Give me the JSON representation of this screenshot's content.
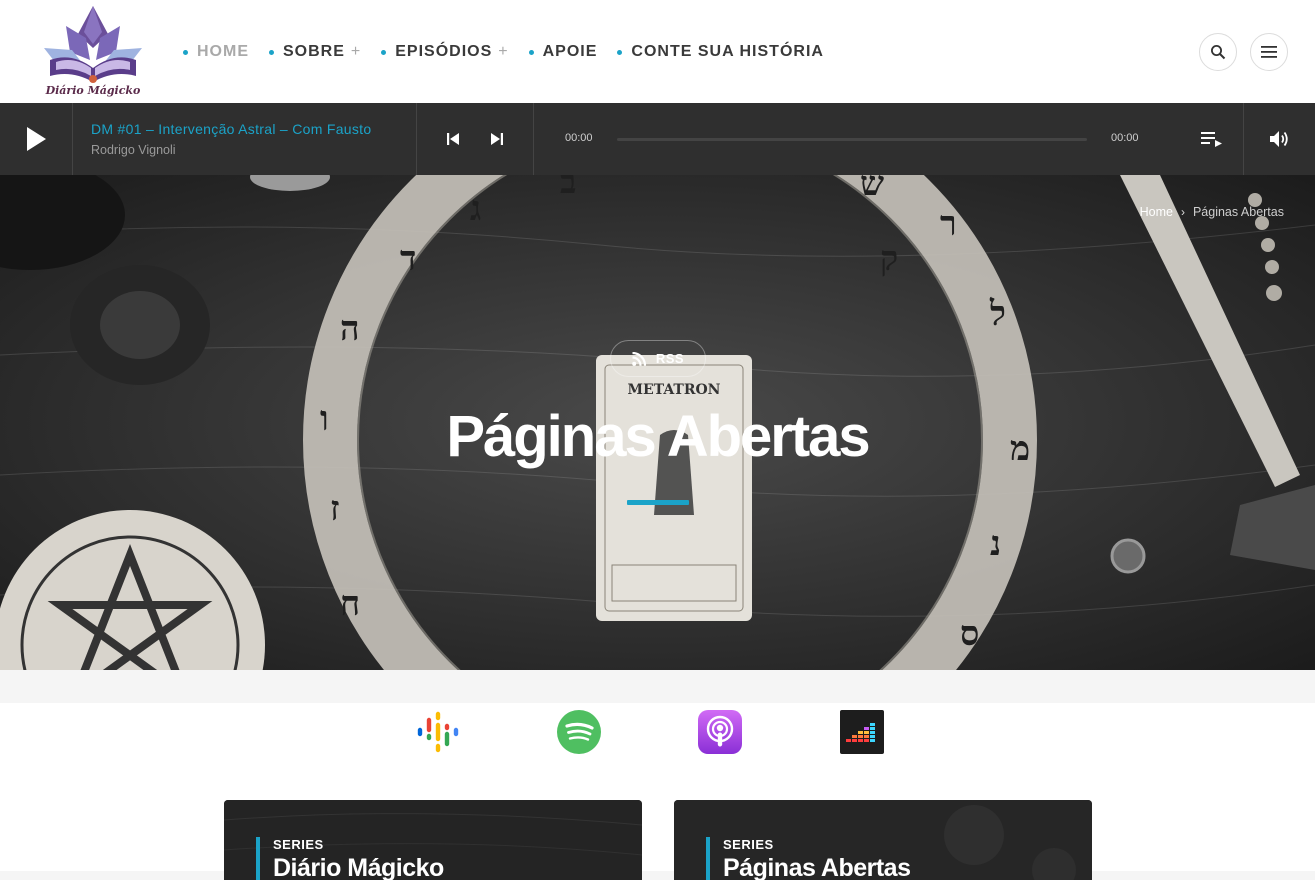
{
  "header": {
    "logo_text": "Diário Mágicko",
    "nav": [
      {
        "label": "HOME",
        "active": true,
        "has_submenu": false
      },
      {
        "label": "SOBRE",
        "active": false,
        "has_submenu": true
      },
      {
        "label": "EPISÓDIOS",
        "active": false,
        "has_submenu": true
      },
      {
        "label": "APOIE",
        "active": false,
        "has_submenu": false
      },
      {
        "label": "CONTE SUA HISTÓRIA",
        "active": false,
        "has_submenu": false
      }
    ],
    "submenu_glyph": "+",
    "search_icon": "search-icon",
    "menu_icon": "hamburger-menu-icon"
  },
  "player": {
    "track_title": "DM #01 – Intervenção Astral – Com Fausto",
    "artist": "Rodrigo Vignoli",
    "current_time": "00:00",
    "duration": "00:00",
    "progress": 0,
    "icons": [
      "play-icon",
      "skip-previous-icon",
      "skip-next-icon",
      "playlist-icon",
      "volume-icon"
    ]
  },
  "hero": {
    "breadcrumb": [
      {
        "label": "Home"
      },
      {
        "label": "Páginas Abertas"
      }
    ],
    "breadcrumb_separator": "›",
    "rss_label": "RSS",
    "title": "Páginas Abertas"
  },
  "platforms": [
    {
      "name": "google-podcasts-icon"
    },
    {
      "name": "spotify-icon"
    },
    {
      "name": "apple-podcasts-icon"
    },
    {
      "name": "deezer-icon"
    }
  ],
  "cards": [
    {
      "label": "SERIES",
      "title": "Diário Mágicko"
    },
    {
      "label": "SERIES",
      "title": "Páginas Abertas"
    }
  ],
  "colors": {
    "accent": "#1ba3c8",
    "player_bg": "#2f2f2f",
    "nav_text": "#3a3a3a",
    "nav_active": "#a9a9a9"
  }
}
